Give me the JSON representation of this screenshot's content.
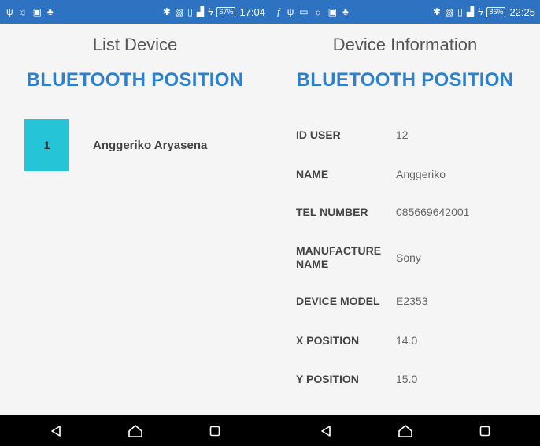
{
  "left": {
    "status_bar": {
      "left_icons": [
        "usb-icon",
        "brightness-icon",
        "gallery-icon",
        "bug-icon"
      ],
      "right_icons": [
        "bluetooth-icon",
        "nfc-icon",
        "vibrate-icon",
        "signal-lte-icon",
        "charging-icon"
      ],
      "battery": "67%",
      "time": "17:04"
    },
    "heading": "List Device",
    "app_title": "BLUETOOTH POSITION",
    "devices": [
      {
        "number": "1",
        "name": "Anggeriko Aryasena"
      }
    ]
  },
  "right": {
    "status_bar": {
      "left_icons": [
        "facebook-icon",
        "usb-icon",
        "gallery-icon",
        "brightness-icon",
        "photo-icon",
        "bug-icon"
      ],
      "right_icons": [
        "bluetooth-icon",
        "nfc-icon",
        "vibrate-icon",
        "signal-lte-icon",
        "charging-icon"
      ],
      "battery": "86%",
      "time": "22:25"
    },
    "heading": "Device Information",
    "app_title": "BLUETOOTH POSITION",
    "info": [
      {
        "label": "ID USER",
        "value": "12"
      },
      {
        "label": "NAME",
        "value": "Anggeriko"
      },
      {
        "label": "TEL NUMBER",
        "value": "085669642001"
      },
      {
        "label": "MANUFACTURE NAME",
        "value": "Sony"
      },
      {
        "label": "DEVICE MODEL",
        "value": "E2353"
      },
      {
        "label": "X POSITION",
        "value": "14.0"
      },
      {
        "label": "Y POSITION",
        "value": "15.0"
      }
    ]
  },
  "nav_bar": {
    "buttons": [
      "back-icon",
      "home-icon",
      "recents-icon"
    ]
  }
}
